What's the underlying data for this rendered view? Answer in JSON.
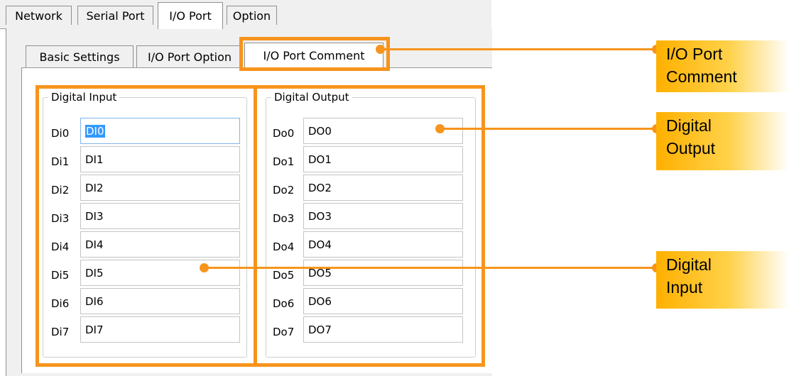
{
  "main_tabs": [
    "Network",
    "Serial Port",
    "I/O Port",
    "Option"
  ],
  "sub_tabs": [
    "Basic Settings",
    "I/O Port Option",
    "I/O Port Comment"
  ],
  "digital_input": {
    "title": "Digital Input",
    "rows": [
      {
        "label": "Di0",
        "value": "DI0"
      },
      {
        "label": "Di1",
        "value": "DI1"
      },
      {
        "label": "Di2",
        "value": "DI2"
      },
      {
        "label": "Di3",
        "value": "DI3"
      },
      {
        "label": "Di4",
        "value": "DI4"
      },
      {
        "label": "Di5",
        "value": "DI5"
      },
      {
        "label": "Di6",
        "value": "DI6"
      },
      {
        "label": "Di7",
        "value": "DI7"
      }
    ]
  },
  "digital_output": {
    "title": "Digital Output",
    "rows": [
      {
        "label": "Do0",
        "value": "DO0"
      },
      {
        "label": "Do1",
        "value": "DO1"
      },
      {
        "label": "Do2",
        "value": "DO2"
      },
      {
        "label": "Do3",
        "value": "DO3"
      },
      {
        "label": "Do4",
        "value": "DO4"
      },
      {
        "label": "Do5",
        "value": "DO5"
      },
      {
        "label": "Do6",
        "value": "DO6"
      },
      {
        "label": "Do7",
        "value": "DO7"
      }
    ]
  },
  "callouts": [
    {
      "line1": "I/O Port",
      "line2": "Comment"
    },
    {
      "line1": "Digital",
      "line2": "Output"
    },
    {
      "line1": "Digital",
      "line2": "Input"
    }
  ],
  "colors": {
    "highlight": "#f7941d",
    "callout": "#ffb000",
    "selection": "#3399ff"
  }
}
